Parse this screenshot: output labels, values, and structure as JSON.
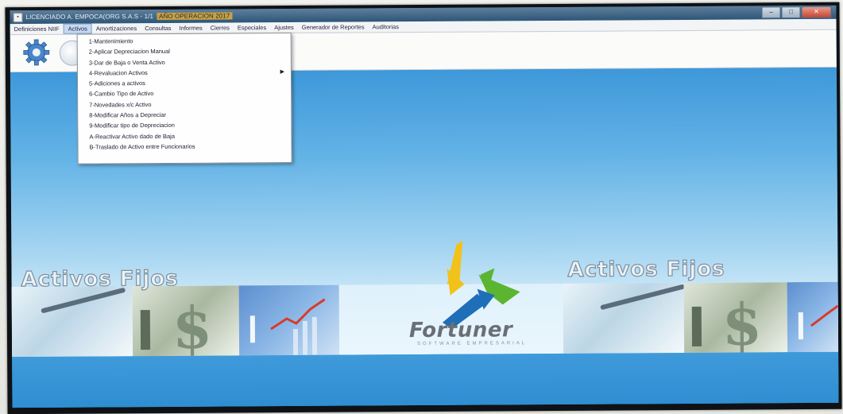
{
  "window": {
    "title": "LICENCIADO A. EMPOCA(ORG S.A.S - 1/1",
    "title_highlight": "AÑO OPERACION 2017"
  },
  "menubar": {
    "items": [
      "Definiciones NIIF",
      "Activos",
      "Amortizaciones",
      "Consultas",
      "Informes",
      "Cierres",
      "Especiales",
      "Ajustes",
      "Generador de Reportes",
      "Auditorias"
    ],
    "active_index": 1
  },
  "activos_menu": {
    "items": [
      {
        "label": "1-Mantenimiento",
        "submenu": false
      },
      {
        "label": "2-Aplicar Depreciacion Manual",
        "submenu": false
      },
      {
        "label": "3-Dar de Baja o Venta Activo",
        "submenu": false
      },
      {
        "label": "4-Revaluacion Activos",
        "submenu": true
      },
      {
        "label": "5-Adiciones a activos",
        "submenu": false
      },
      {
        "label": "6-Cambio Tipo de Activo",
        "submenu": false
      },
      {
        "label": "7-Novedades x/c Activo",
        "submenu": false
      },
      {
        "label": "8-Modificar Años a Depreciar",
        "submenu": false
      },
      {
        "label": "9-Modificar tipo de Depreciacion",
        "submenu": false
      },
      {
        "label": "A-Reactivar Activo dado de Baja",
        "submenu": false
      },
      {
        "label": "B-Traslado de Activo entre Funcionarios",
        "submenu": false
      }
    ]
  },
  "toolbar": {
    "icons": [
      "gear-icon",
      "globe-icon"
    ]
  },
  "desktop": {
    "watermark_left": "Activos Fijos",
    "watermark_right": "Activos Fijos",
    "logo_name": "Fortuner",
    "logo_tagline": "SOFTWARE EMPRESARIAL"
  },
  "colors": {
    "desktop_blue": "#3b98d7",
    "logo_yellow": "#f2c21b",
    "logo_green": "#5cb531",
    "logo_blue": "#1f6fb8"
  }
}
